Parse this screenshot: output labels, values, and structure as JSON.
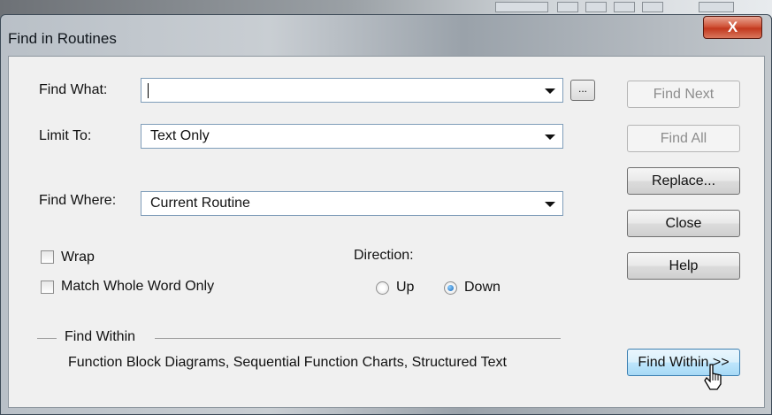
{
  "window": {
    "title": "Find in Routines",
    "close_glyph": "X"
  },
  "find_what": {
    "label": "Find What:",
    "value": "",
    "browse_label": "..."
  },
  "limit_to": {
    "label": "Limit To:",
    "selected": "Text Only"
  },
  "find_where": {
    "label": "Find Where:",
    "selected": "Current Routine"
  },
  "options": {
    "wrap_label": "Wrap",
    "wrap_checked": false,
    "whole_word_label": "Match Whole Word Only",
    "whole_word_checked": false
  },
  "direction": {
    "label": "Direction:",
    "up_label": "Up",
    "down_label": "Down",
    "selected": "Down"
  },
  "buttons": {
    "find_next": "Find Next",
    "find_all": "Find All",
    "replace": "Replace...",
    "close": "Close",
    "help": "Help",
    "find_within": "Find Within >>"
  },
  "find_within": {
    "heading": "Find Within",
    "description": "Function Block Diagrams, Sequential Function Charts, Structured Text"
  }
}
